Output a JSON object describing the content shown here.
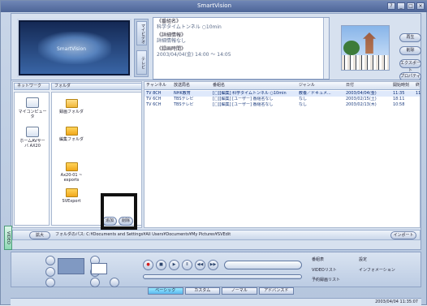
{
  "app": {
    "title": "SmartVision",
    "window_buttons": [
      "?",
      "_",
      "□",
      "×"
    ]
  },
  "left_tabs": [
    "マイビデオ",
    "テレビ"
  ],
  "details": {
    "title_label": "《番組名》",
    "title_value": "科学タイムトンネル ○10min",
    "info_label": "《詳細情報》",
    "info_value": "詳細情報なし",
    "time_label": "《録画時間》",
    "time_value": "2003/04/04(金) 14:00 〜 14:05"
  },
  "actions": [
    "再生",
    "削除",
    "エクスポート",
    "プロパティ"
  ],
  "panes": {
    "network": "ネットワーク",
    "folder": "フォルダ"
  },
  "network_items": [
    {
      "label": "マイコンピュータ"
    },
    {
      "label": "ホームAVサーバ AX20"
    }
  ],
  "folders": [
    {
      "label": "録画フォルダ"
    },
    {
      "label": "編集フォルダ"
    },
    {
      "label": "Ax20-01 ~ exports"
    },
    {
      "label": "SVExport"
    }
  ],
  "folder_buttons": [
    "追加",
    "削除"
  ],
  "table": {
    "headers": [
      "チャンネル",
      "放送局名",
      "番組名",
      "ジャンル",
      "日付",
      "開始時刻",
      "終"
    ],
    "rows": [
      [
        "TV 8CH",
        "NHK教育",
        "[□][編集] 科学タイムトンネル ○10min",
        "教養／ドキュメ...",
        "2003/04/04(金)",
        "11:35",
        "11"
      ],
      [
        "TV 6CH",
        "TBSテレビ",
        "[□][編集] [ユーザー] 番組名なし",
        "なし",
        "2003/02/15(土)",
        "18:11",
        ""
      ],
      [
        "TV 6CH",
        "TBSテレビ",
        "[□][編集] [ユーザー] 番組名なし",
        "なし",
        "2003/02/13(木)",
        "10:58",
        ""
      ]
    ]
  },
  "pathbar": {
    "expand": "拡大",
    "path": "フォルダのパス: C:¥Documents and Settings¥All Users¥Documents¥My Pictures¥SVEdit",
    "import": "インポート"
  },
  "video_tab": "VIDEO",
  "controls": {
    "right": [
      "番組表",
      "設定",
      "VIDEOリスト",
      "インフォメーション",
      "予約録画リスト"
    ],
    "mode_tabs": [
      "ベーシック",
      "カスタム",
      "ノーマル",
      "アドバンスド"
    ]
  },
  "status_time": "2003/04/04 11:35:07"
}
